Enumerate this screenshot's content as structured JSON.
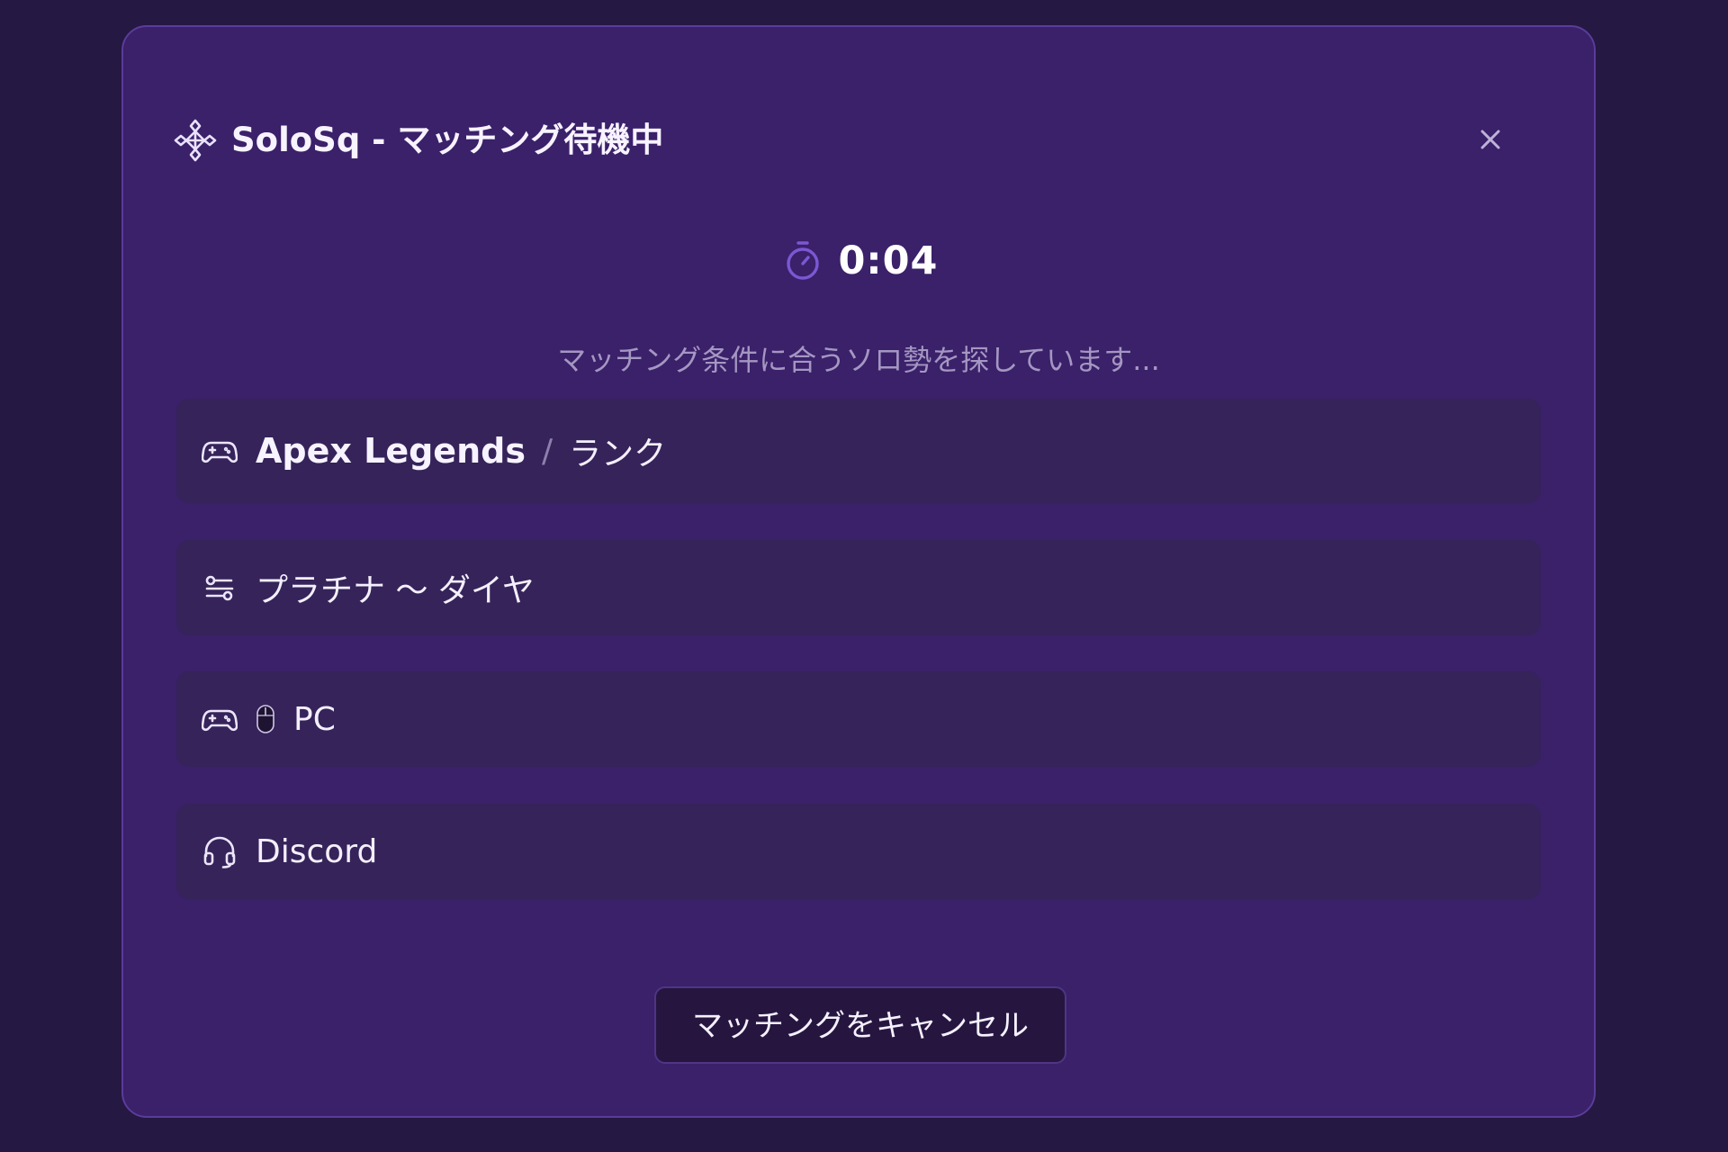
{
  "header": {
    "title": "SoloSq - マッチング待機中",
    "logo_icon": "move-diamond-icon",
    "close_icon": "close-icon"
  },
  "timer": {
    "icon": "stopwatch-icon",
    "value": "0:04"
  },
  "status_message": "マッチング条件に合うソロ勢を探しています...",
  "criteria": {
    "game": {
      "icon": "gamepad-icon",
      "title": "Apex Legends",
      "separator": "/",
      "mode": "ランク"
    },
    "rank": {
      "icon": "sliders-icon",
      "label": "プラチナ 〜 ダイヤ"
    },
    "platform": {
      "icon": "gamepad-icon",
      "sub_icon": "mouse-icon",
      "label": "PC"
    },
    "voice": {
      "icon": "headset-icon",
      "label": "Discord"
    }
  },
  "actions": {
    "cancel_label": "マッチングをキャンセル"
  },
  "colors": {
    "page_bg": "#251842",
    "modal_bg": "#3b206a",
    "modal_border": "#5a3c9a",
    "row_bg": "#35235a",
    "button_bg": "#26163f",
    "accent": "#7b58d2",
    "muted_text": "#a497c2"
  }
}
